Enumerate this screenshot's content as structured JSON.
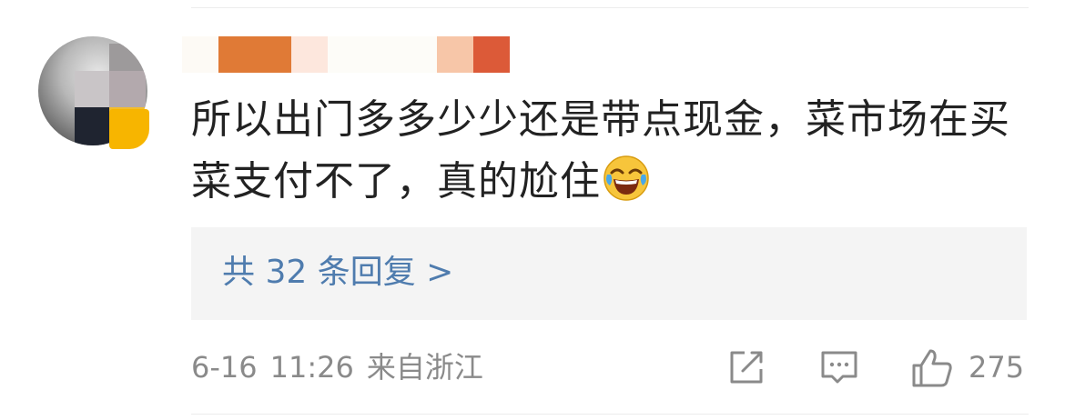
{
  "comment": {
    "text_line1": "所以出门多多少少还是带点现金，菜市场在买",
    "text_line2": "菜支付不了，真的尬住",
    "emoji": "laugh-cry-emoji"
  },
  "replies": {
    "label": "共 32 条回复 >"
  },
  "meta": {
    "date": "6-16",
    "time": "11:26",
    "location": "来自浙江"
  },
  "actions": {
    "share_icon": "share-icon",
    "comment_icon": "comment-icon",
    "like_icon": "like-icon",
    "like_count": "275"
  },
  "colors": {
    "link": "#4f7cae",
    "meta": "#8a8a8a",
    "text": "#222222",
    "reply_bg": "#f4f4f4"
  }
}
